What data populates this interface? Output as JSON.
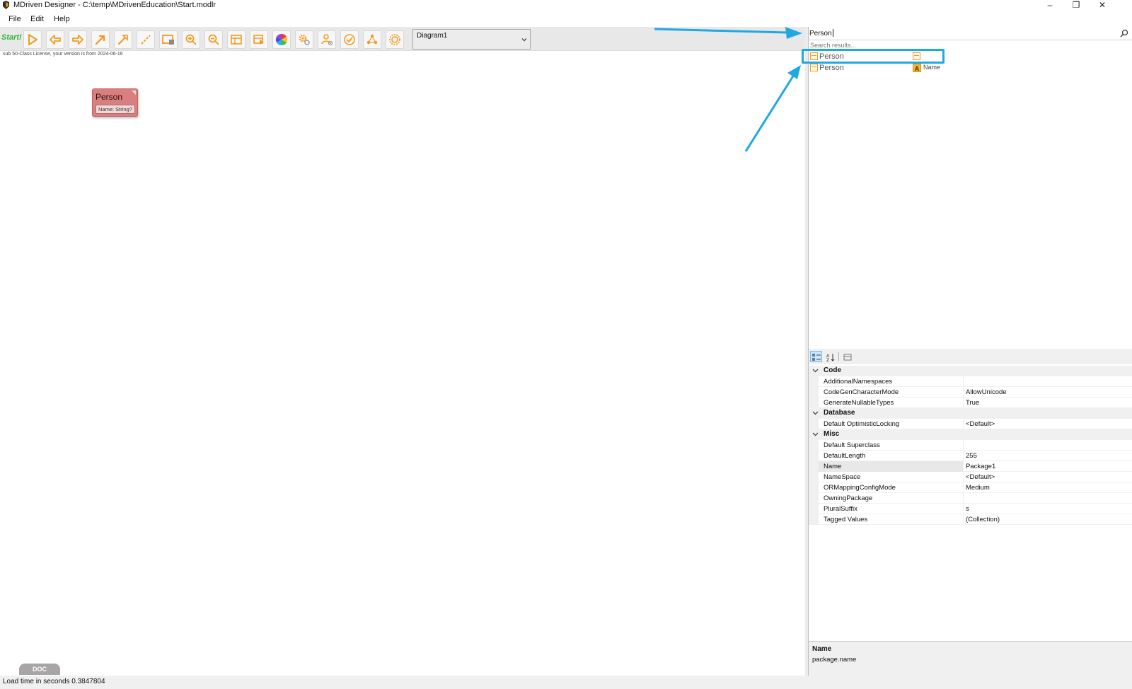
{
  "window": {
    "title": "MDriven Designer - C:\\temp\\MDrivenEducation\\Start.modlr",
    "minimize_glyph": "–",
    "restore_glyph": "❐",
    "close_glyph": "✕"
  },
  "menu": {
    "items": [
      "File",
      "Edit",
      "Help"
    ]
  },
  "toolbar": {
    "start_label": "Start!",
    "icons": [
      "play-icon",
      "back-icon",
      "forward-icon",
      "association-arrow-icon",
      "inheritance-arrow-icon",
      "line-icon",
      "add-class-icon",
      "zoom-in-icon",
      "zoom-out-icon",
      "viewmodel-icon",
      "action-icon",
      "color-wheel-icon",
      "gear-settings-icon",
      "users-icon",
      "check-icon",
      "graph-icon",
      "sun-settings-icon"
    ],
    "diagram_select": {
      "value": "Diagram1"
    }
  },
  "canvas": {
    "license_text": "sub 50-Class License, your version is from 2024-06-16",
    "class_box": {
      "name": "Person",
      "attribute": "Name: String?"
    },
    "doc_tab": "DOC"
  },
  "search": {
    "value": "Person",
    "hint": "Search results...",
    "results": [
      {
        "label": "Person",
        "kind": "class"
      },
      {
        "label": "Person",
        "kind": "attribute",
        "sub": "Name"
      }
    ]
  },
  "properties": {
    "categories": [
      {
        "name": "Code",
        "rows": [
          {
            "name": "AdditionalNamespaces",
            "value": ""
          },
          {
            "name": "CodeGenCharacterMode",
            "value": "AllowUnicode"
          },
          {
            "name": "GenerateNullableTypes",
            "value": "True"
          }
        ]
      },
      {
        "name": "Database",
        "rows": [
          {
            "name": "Default OptimisticLocking",
            "value": "<Default>"
          }
        ]
      },
      {
        "name": "Misc",
        "rows": [
          {
            "name": "Default Superclass",
            "value": ""
          },
          {
            "name": "DefaultLength",
            "value": "255"
          },
          {
            "name": "Name",
            "value": "Package1"
          },
          {
            "name": "NameSpace",
            "value": "<Default>"
          },
          {
            "name": "ORMappingConfigMode",
            "value": "Medium"
          },
          {
            "name": "OwningPackage",
            "value": ""
          },
          {
            "name": "PluralSuffix",
            "value": "s"
          },
          {
            "name": "Tagged Values",
            "value": "(Collection)"
          }
        ]
      }
    ],
    "description": {
      "title": "Name",
      "text": "package.name"
    }
  },
  "status": {
    "text": "Load time in seconds 0.3847804"
  },
  "colors": {
    "accent_callout": "#1fa9e3",
    "class_fill": "#d97f7f",
    "start_green": "#32b43a",
    "icon_orange": "#f39a1e"
  }
}
